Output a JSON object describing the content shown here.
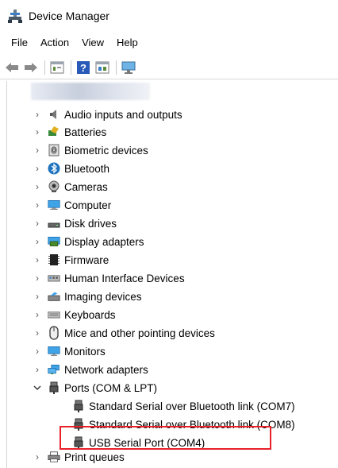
{
  "window": {
    "title": "Device Manager"
  },
  "menu": [
    "File",
    "Action",
    "View",
    "Help"
  ],
  "toolbar": {
    "icons": [
      "back-arrow-icon",
      "forward-arrow-icon",
      "properties-icon",
      "help-icon",
      "update-driver-icon",
      "monitor-scan-icon"
    ]
  },
  "tree": {
    "categories": [
      {
        "label": "Audio inputs and outputs",
        "icon": "speaker-icon",
        "expanded": false
      },
      {
        "label": "Batteries",
        "icon": "battery-icon",
        "expanded": false
      },
      {
        "label": "Biometric devices",
        "icon": "fingerprint-icon",
        "expanded": false
      },
      {
        "label": "Bluetooth",
        "icon": "bluetooth-icon",
        "expanded": false
      },
      {
        "label": "Cameras",
        "icon": "camera-icon",
        "expanded": false
      },
      {
        "label": "Computer",
        "icon": "computer-icon",
        "expanded": false
      },
      {
        "label": "Disk drives",
        "icon": "disk-drive-icon",
        "expanded": false
      },
      {
        "label": "Display adapters",
        "icon": "display-adapter-icon",
        "expanded": false
      },
      {
        "label": "Firmware",
        "icon": "chip-icon",
        "expanded": false
      },
      {
        "label": "Human Interface Devices",
        "icon": "hid-icon",
        "expanded": false
      },
      {
        "label": "Imaging devices",
        "icon": "imaging-icon",
        "expanded": false
      },
      {
        "label": "Keyboards",
        "icon": "keyboard-icon",
        "expanded": false
      },
      {
        "label": "Mice and other pointing devices",
        "icon": "mouse-icon",
        "expanded": false
      },
      {
        "label": "Monitors",
        "icon": "monitor-icon",
        "expanded": false
      },
      {
        "label": "Network adapters",
        "icon": "network-icon",
        "expanded": false
      },
      {
        "label": "Ports (COM & LPT)",
        "icon": "port-icon",
        "expanded": true,
        "children": [
          "Standard Serial over Bluetooth link (COM7)",
          "Standard Serial over Bluetooth link (COM8)",
          "USB Serial Port (COM4)"
        ]
      },
      {
        "label": "Print queues",
        "icon": "printer-icon",
        "expanded": false
      }
    ]
  },
  "colors": {
    "highlight": "#e8202a",
    "icon_blue": "#1e73be"
  }
}
